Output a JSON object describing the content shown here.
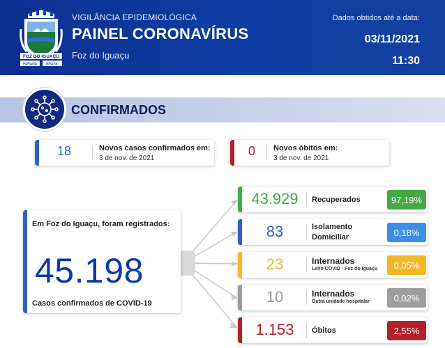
{
  "header": {
    "subtitle": "VIGILÂNCIA EPIDEMIOLÓGICA",
    "title": "PAINEL CORONAVÍRUS",
    "city": "Foz do Iguaçu",
    "data_label": "Dados obtidos até a data:",
    "date": "03/11/2021",
    "time": "11:30",
    "crest_text_1": "FOZ DO IGUAÇU",
    "crest_text_2": "PARANÁ",
    "crest_text_3": "BRASIL"
  },
  "section": {
    "title": "CONFIRMADOS",
    "icon": "virus-icon"
  },
  "new_cases": {
    "value": "18",
    "label": "Novos casos confirmados em:",
    "date": "3 de nov. de 2021",
    "color": "#2f62c9"
  },
  "new_deaths": {
    "value": "0",
    "label": "Novos óbitos em:",
    "date": "3 de nov. de 2021",
    "color": "#b3202a"
  },
  "total": {
    "label": "Em Foz do Iguaçu, foram registrados:",
    "value": "45.198",
    "footer": "Casos confirmados de COVID-19",
    "color": "#2f62c9"
  },
  "stats": [
    {
      "value": "43.929",
      "label": "Recuperados",
      "sub": "",
      "percent": "97,19%",
      "color": "#3fae49",
      "pct_color": "#43a845"
    },
    {
      "value": "83",
      "label": "Isolamento",
      "label2": "Domiciliar",
      "sub": "",
      "percent": "0,18%",
      "color": "#2f62c9",
      "pct_color": "#3b8ee8"
    },
    {
      "value": "23",
      "label": "Internados",
      "sub": "Leito COVID - Foz do Iguaçu",
      "percent": "0,05%",
      "color": "#f5b72b",
      "pct_color": "#f3b625"
    },
    {
      "value": "10",
      "label": "Internados",
      "sub": "Outra unidade hospitalar",
      "percent": "0,02%",
      "color": "#9b9b9b",
      "pct_color": "#9e9e9e"
    },
    {
      "value": "1.153",
      "label": "Óbitos",
      "sub": "",
      "percent": "2,55%",
      "color": "#b3202a",
      "pct_color": "#b3202a"
    }
  ]
}
